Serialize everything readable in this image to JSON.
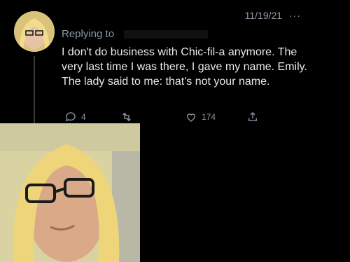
{
  "tweet": {
    "timestamp": "11/19/21",
    "more": "···",
    "replying_label": "Replying to",
    "text": "I don't do business with Chic-fil-a anymore. The very last time I was there, I gave my name. Emily. The lady said to me: that's not your name.",
    "replies": "4",
    "likes": "174"
  },
  "icons": {
    "reply": "reply-icon",
    "retweet": "retweet-icon",
    "like": "heart-icon",
    "share": "share-icon",
    "more": "more-icon"
  },
  "colors": {
    "background": "#000000",
    "text": "#e7e9ea",
    "muted": "#8b98a5"
  }
}
